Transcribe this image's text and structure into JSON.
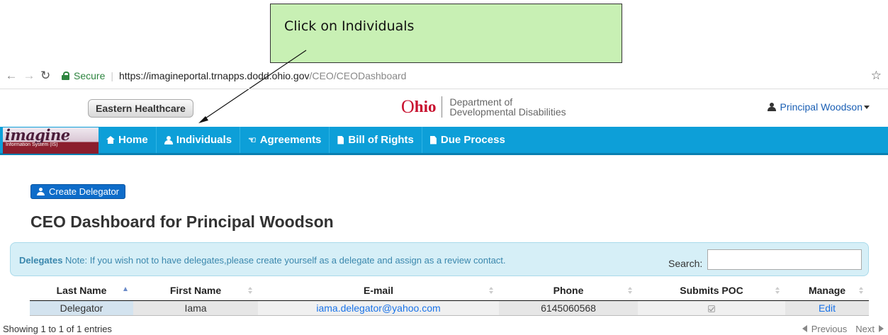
{
  "callout": {
    "text": "Click on Individuals"
  },
  "browser": {
    "secure_label": "Secure",
    "url_host": "https://imagineportal.trnapps.dodd.ohio.gov",
    "url_path": "/CEO/CEODashboard"
  },
  "header": {
    "org_button": "Eastern Healthcare",
    "logo_o": "O",
    "logo_rest": "hio",
    "dept_line1": "Department of",
    "dept_line2": "Developmental Disabilities",
    "user_name": "Principal Woodson"
  },
  "nav": {
    "brand": "imagine",
    "brand_sub": "Information System (IS)",
    "items": [
      "Home",
      "Individuals",
      "Agreements",
      "Bill of Rights",
      "Due Process"
    ]
  },
  "content": {
    "create_button": "Create Delegator",
    "title": "CEO Dashboard for Principal Woodson"
  },
  "panel": {
    "note_bold": "Delegates",
    "note_text": " Note: If you wish not to have delegates,please create yourself as a delegate and assign as a review contact.",
    "search_label": "Search:",
    "search_value": ""
  },
  "table": {
    "headers": [
      "Last Name",
      "First Name",
      "E-mail",
      "Phone",
      "Submits POC",
      "Manage"
    ],
    "rows": [
      {
        "last": "Delegator",
        "first": "Iama",
        "email": "iama.delegator@yahoo.com",
        "phone": "6145060568",
        "submits_poc": true,
        "manage": "Edit"
      }
    ]
  },
  "footer": {
    "info": "Showing 1 to 1 of 1 entries",
    "previous": "Previous",
    "next": "Next"
  },
  "colors": {
    "nav_bar": "#0d9fd8",
    "callout_bg": "#c8f0b4",
    "ohio_red": "#c8102e",
    "primary_button": "#0e6cc9"
  }
}
